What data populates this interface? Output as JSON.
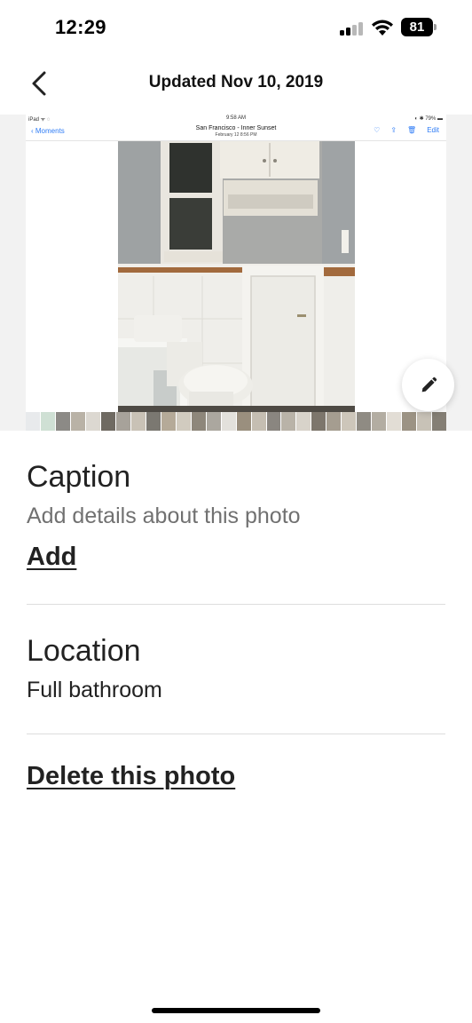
{
  "status_bar": {
    "time": "12:29",
    "battery": "81"
  },
  "header": {
    "title": "Updated Nov 10, 2019"
  },
  "photo": {
    "ipad_status_left": "iPad ᯤ ◌",
    "ipad_status_time": "9:58 AM",
    "ipad_status_right": "◐ ✱ 79% ▬",
    "ipad_back_label": "Moments",
    "ipad_title": "San Francisco - Inner Sunset",
    "ipad_subtitle": "February 12 8:56 PM",
    "ipad_edit_label": "Edit"
  },
  "caption": {
    "title": "Caption",
    "hint": "Add details about this photo",
    "add_label": "Add"
  },
  "location": {
    "title": "Location",
    "value": "Full bathroom"
  },
  "delete_label": "Delete this photo",
  "colors": {
    "text_primary": "#222222",
    "text_secondary": "#717171",
    "divider": "#dddddd",
    "ios_blue": "#2f7cf6"
  },
  "icons": [
    "chevron-left-icon",
    "pencil-icon",
    "heart-icon",
    "share-icon",
    "trash-icon",
    "wifi-icon",
    "signal-icon",
    "battery-icon"
  ]
}
